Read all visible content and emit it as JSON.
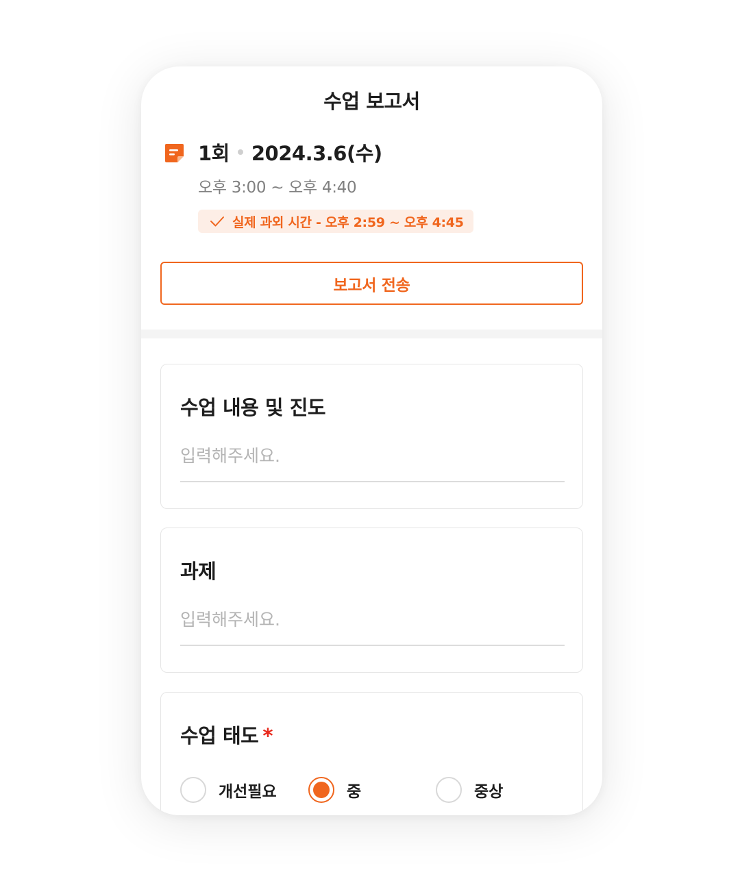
{
  "header": {
    "title": "수업 보고서"
  },
  "session": {
    "number": "1회",
    "date": "2024.3.6(수)",
    "scheduled_time": "오후 3:00 ~ 오후 4:40",
    "actual_time": "실제 과외 시간 - 오후 2:59 ~ 오후 4:45"
  },
  "actions": {
    "send_label": "보고서 전송"
  },
  "form": {
    "content": {
      "label": "수업 내용 및 진도",
      "value": "",
      "placeholder": "입력해주세요."
    },
    "homework": {
      "label": "과제",
      "value": "",
      "placeholder": "입력해주세요."
    },
    "attitude": {
      "label": "수업 태도",
      "required_mark": "*",
      "options": [
        {
          "label": "개선필요",
          "selected": false
        },
        {
          "label": "중",
          "selected": true
        },
        {
          "label": "중상",
          "selected": false
        }
      ]
    }
  },
  "colors": {
    "accent": "#f0661e",
    "badge_bg": "#fdeee6",
    "required": "#e8291c",
    "text": "#1e1e1e",
    "muted": "#808080",
    "placeholder": "#b4b4b4"
  },
  "icons": {
    "session": "memo-icon",
    "actual_time": "check-icon"
  }
}
